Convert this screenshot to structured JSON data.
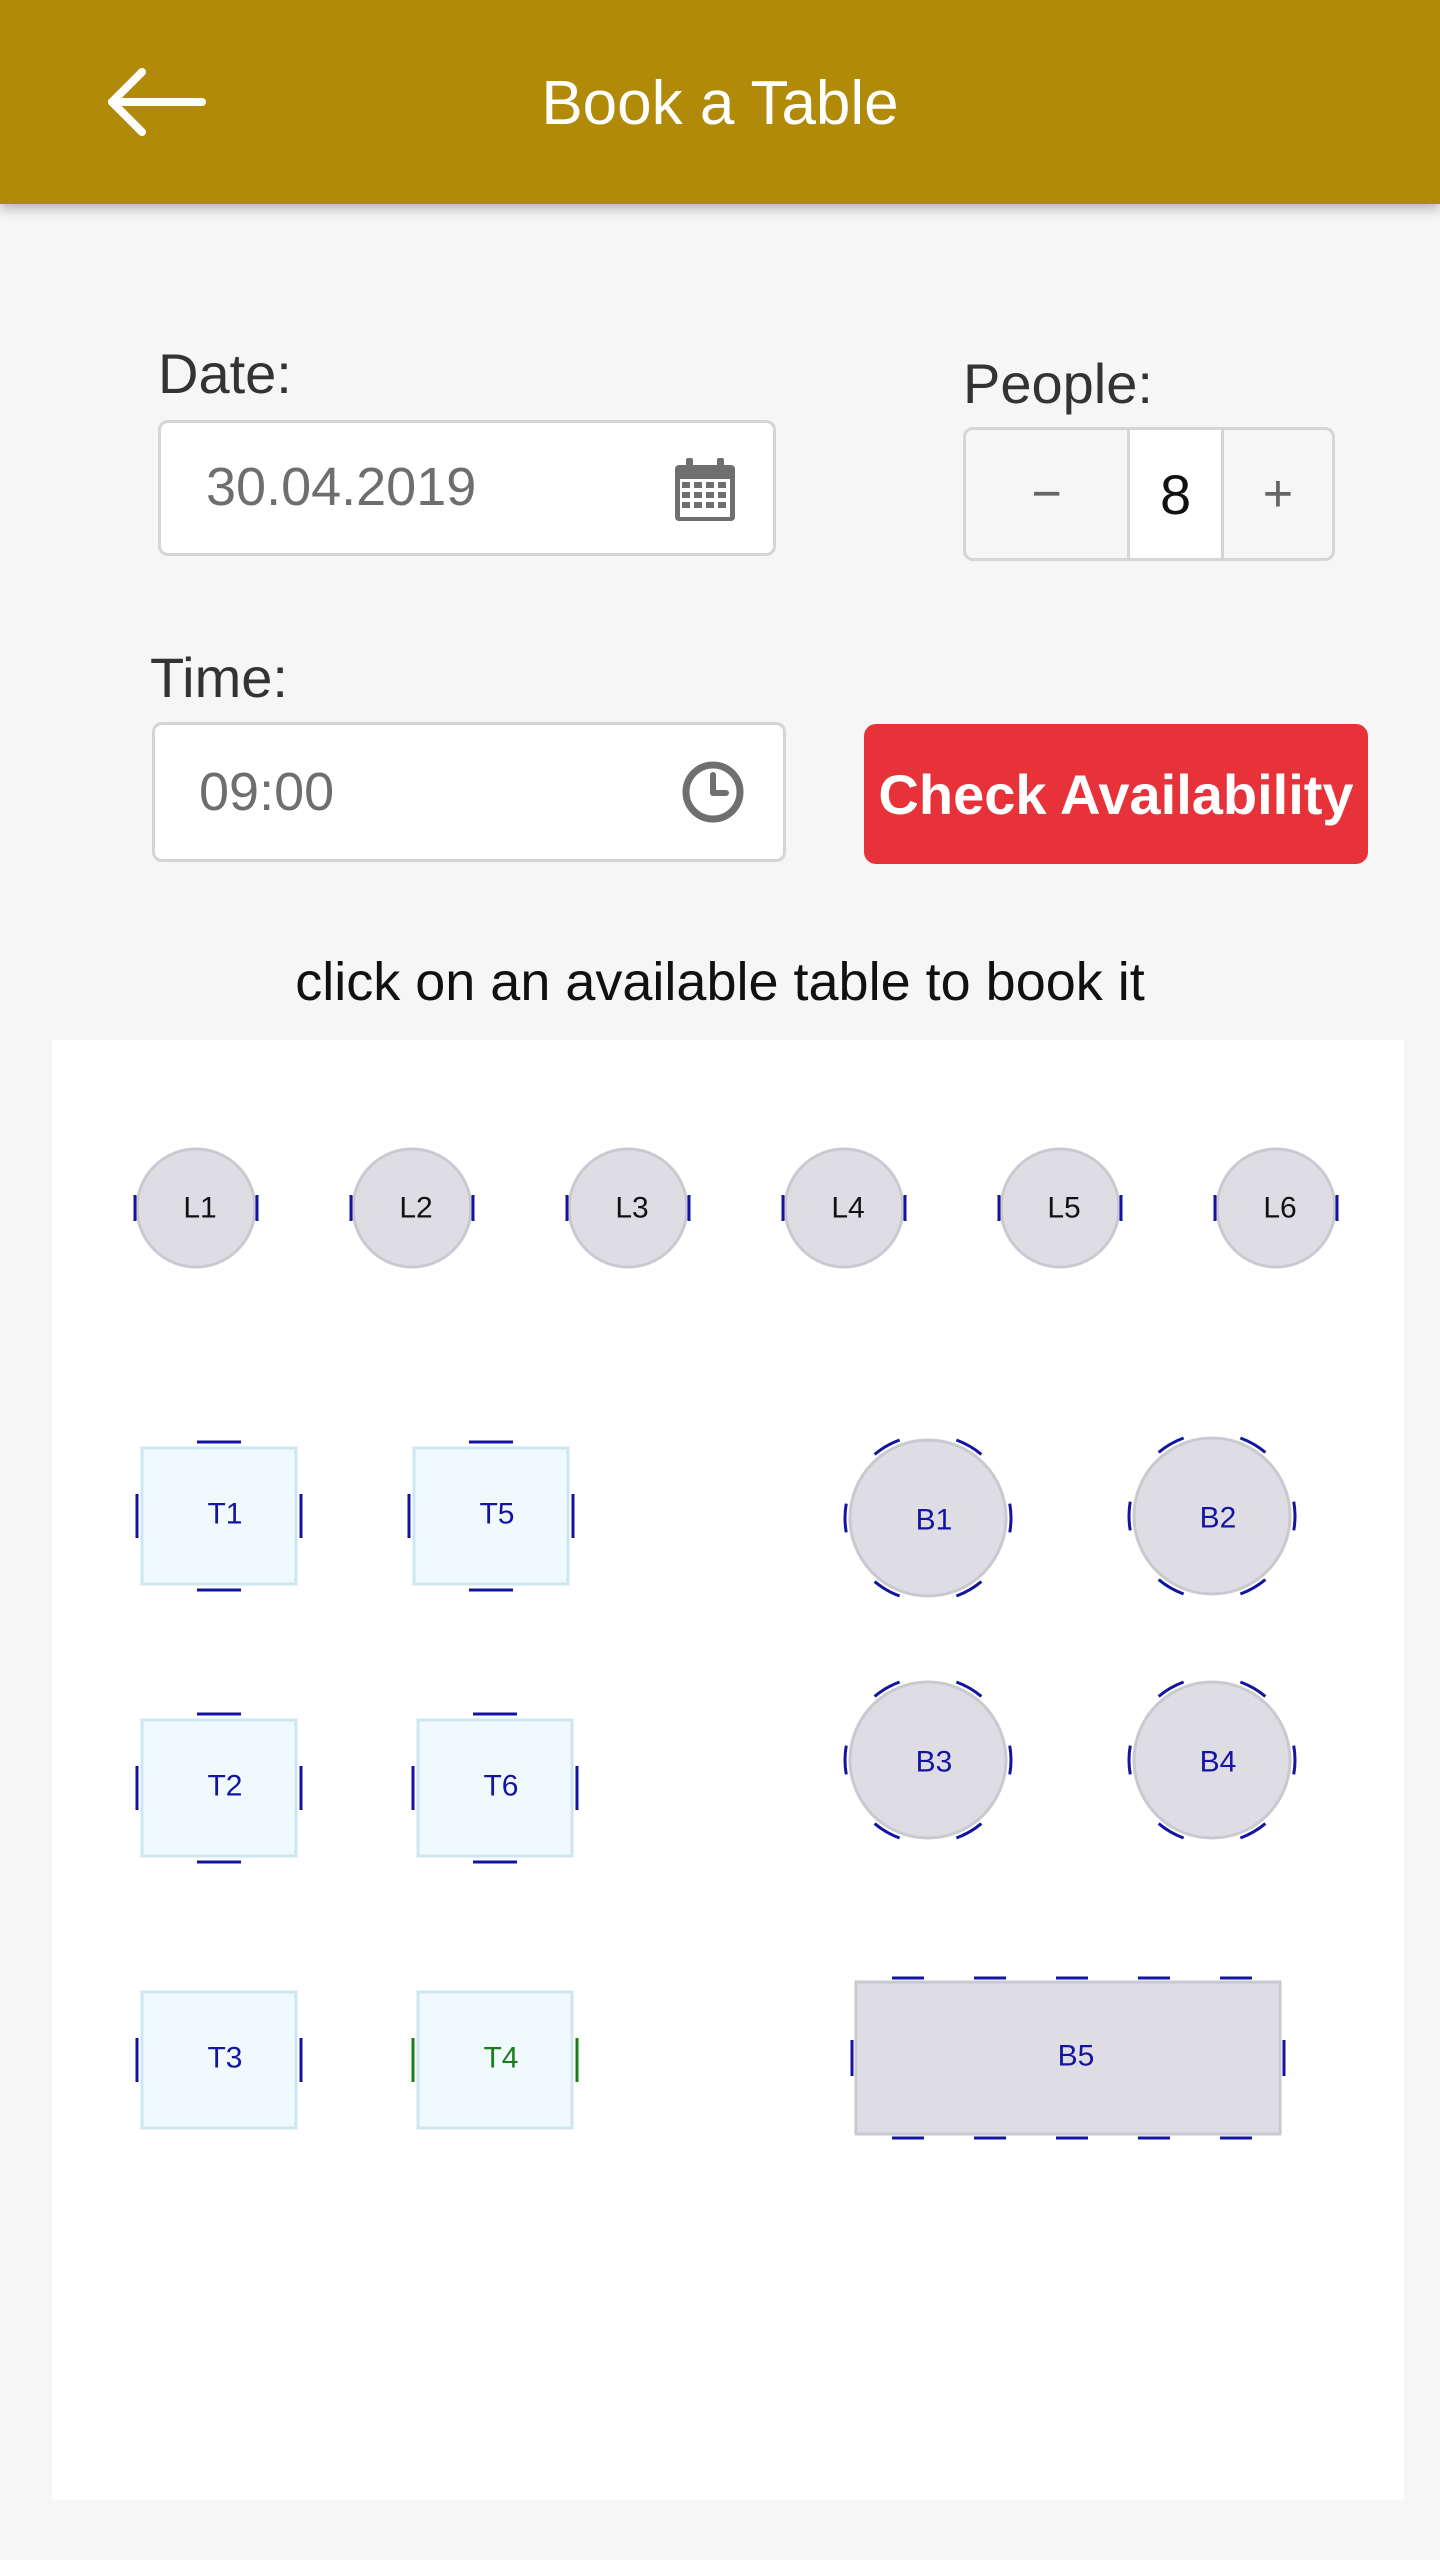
{
  "appbar": {
    "title": "Book a Table",
    "back_icon": "arrow-left-icon",
    "color": "#b08a08"
  },
  "form": {
    "date_label": "Date:",
    "date_value": "30.04.2019",
    "people_label": "People:",
    "people_value": "8",
    "minus_label": "−",
    "plus_label": "+",
    "time_label": "Time:",
    "time_value": "09:00",
    "check_button": "Check Availability",
    "check_button_color": "#e8323a"
  },
  "floor": {
    "hint": "click on an available table to book it",
    "lounge_tables": [
      "L1",
      "L2",
      "L3",
      "L4",
      "L5",
      "L6"
    ],
    "standard_tables": [
      {
        "id": "T1",
        "available": false
      },
      {
        "id": "T5",
        "available": false
      },
      {
        "id": "T2",
        "available": false
      },
      {
        "id": "T6",
        "available": false
      },
      {
        "id": "T3",
        "available": false
      },
      {
        "id": "T4",
        "available": true
      }
    ],
    "booth_tables": [
      "B1",
      "B2",
      "B3",
      "B4"
    ],
    "banquet_table": "B5",
    "colors": {
      "available": "#1a7f1a",
      "unavailable": "#1414a0",
      "lounge_text": "#111111"
    }
  }
}
